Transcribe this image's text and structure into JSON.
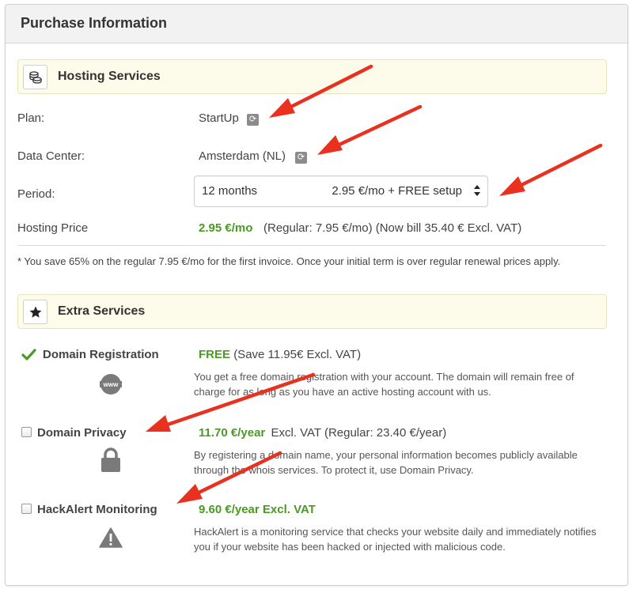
{
  "panel": {
    "title": "Purchase Information"
  },
  "hosting": {
    "section_title": "Hosting Services",
    "icon": "coins-icon",
    "plan_label": "Plan:",
    "plan_value": "StartUp",
    "datacenter_label": "Data Center:",
    "datacenter_value": "Amsterdam (NL)",
    "period_label": "Period:",
    "period_months": "12 months",
    "period_price": "2.95 €/mo + FREE setup",
    "price_label": "Hosting Price",
    "price_value": "2.95 €/mo",
    "price_detail": "(Regular: 7.95 €/mo) (Now bill 35.40 € Excl. VAT)",
    "savings_note": "* You save 65% on the regular 7.95 €/mo for the first invoice. Once your initial term is over regular renewal prices apply."
  },
  "extras": {
    "section_title": "Extra Services",
    "icon": "star-icon",
    "domain_registration": {
      "name": "Domain Registration",
      "price": "FREE",
      "price_detail": "(Save 11.95€ Excl. VAT)",
      "description": "You get a free domain registration with your account. The domain will remain free of charge for as long as you have an active hosting account with us.",
      "checked": true,
      "icon": "www-icon"
    },
    "domain_privacy": {
      "name": "Domain Privacy",
      "price": "11.70 €/year",
      "price_detail": "Excl. VAT (Regular: 23.40 €/year)",
      "description": "By registering a domain name, your personal information becomes publicly available through the whois services. To protect it, use Domain Privacy.",
      "checked": false,
      "icon": "lock-icon"
    },
    "hackalert": {
      "name": "HackAlert Monitoring",
      "price": "9.60 €/year Excl. VAT",
      "description": "HackAlert is a monitoring service that checks your website daily and immediately notifies you if your website has been hacked or injected with malicious code.",
      "checked": false,
      "icon": "warning-icon"
    }
  },
  "colors": {
    "price_green": "#4a9a25",
    "section_bg": "#fdfcea",
    "annotation_arrow": "#e8321f"
  }
}
